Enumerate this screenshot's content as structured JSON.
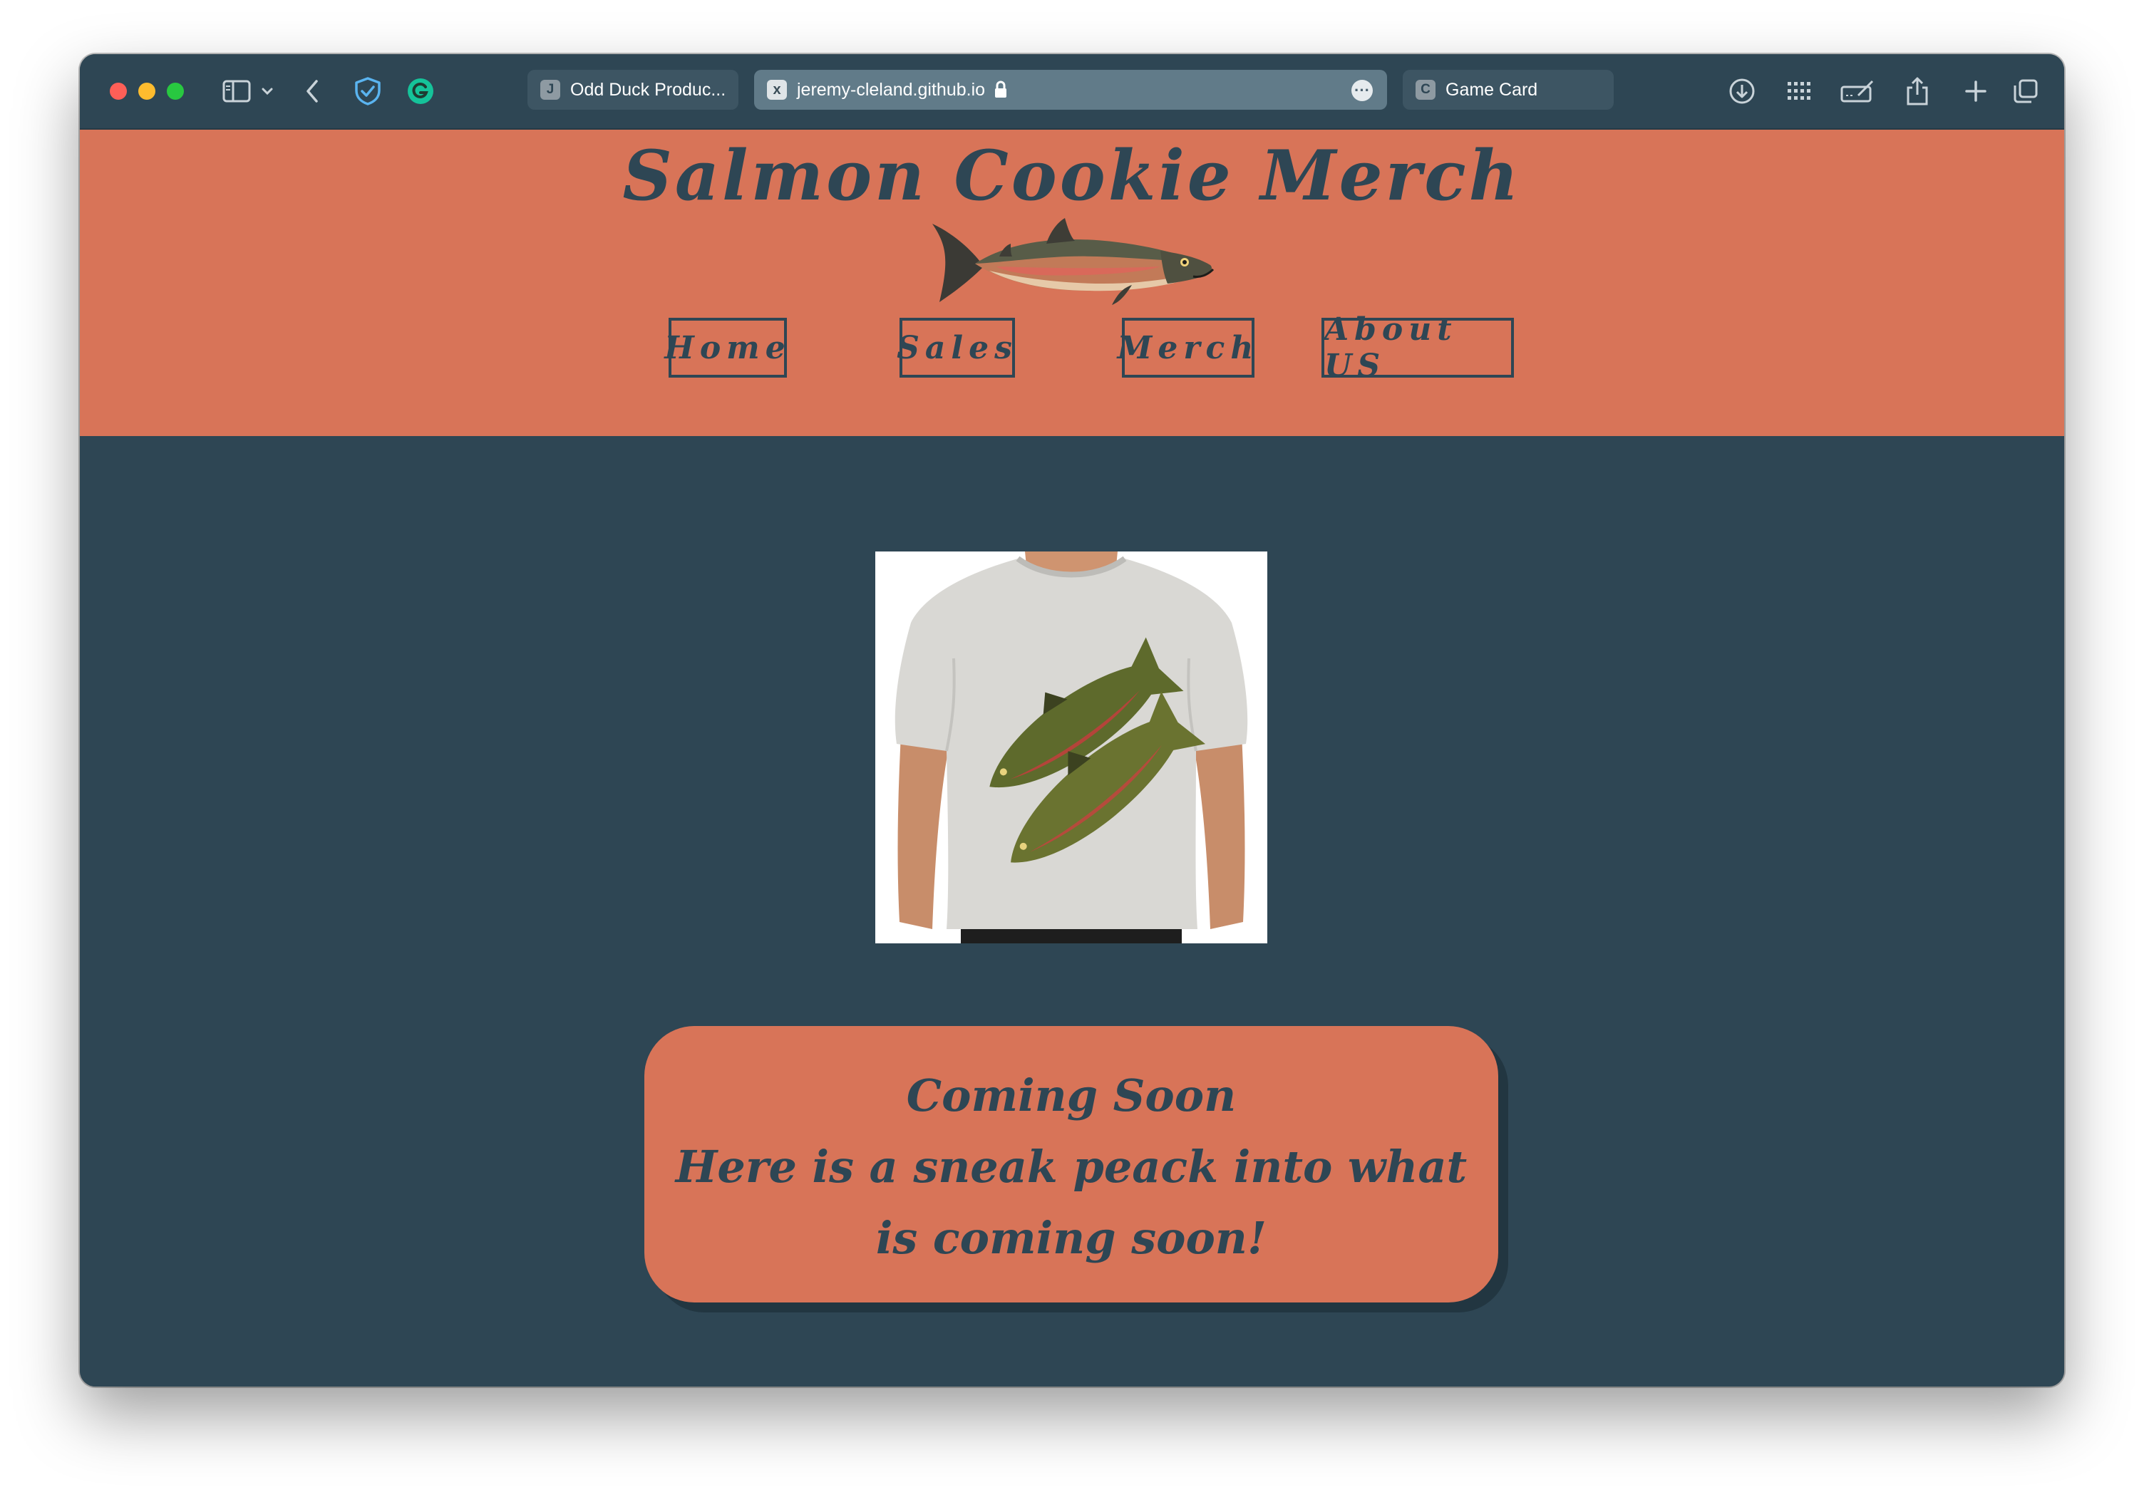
{
  "browser": {
    "tabs": [
      {
        "favicon": "J",
        "label": "Odd Duck Produc..."
      },
      {
        "favicon": "x",
        "label": "jeremy-cleland.github.io"
      },
      {
        "favicon": "C",
        "label": "Game Card"
      }
    ],
    "icons": {
      "sidebar": "sidebar-icon",
      "back": "chevron-left-icon",
      "shield": "shield-check-icon",
      "grammarly": "grammarly-icon",
      "download": "download-icon",
      "grid": "grid-icon",
      "annotate": "annotate-icon",
      "share": "share-icon",
      "new_tab": "plus-icon",
      "tab_overview": "tabs-icon"
    }
  },
  "page": {
    "title": "Salmon Cookie Merch",
    "nav": [
      "Home",
      "Sales",
      "Merch",
      "About US"
    ],
    "notice": {
      "line1": "Coming Soon",
      "line2": "Here is a sneak peack into what is coming soon!"
    },
    "colors": {
      "background": "#2e4654",
      "accent": "#d87458"
    }
  }
}
